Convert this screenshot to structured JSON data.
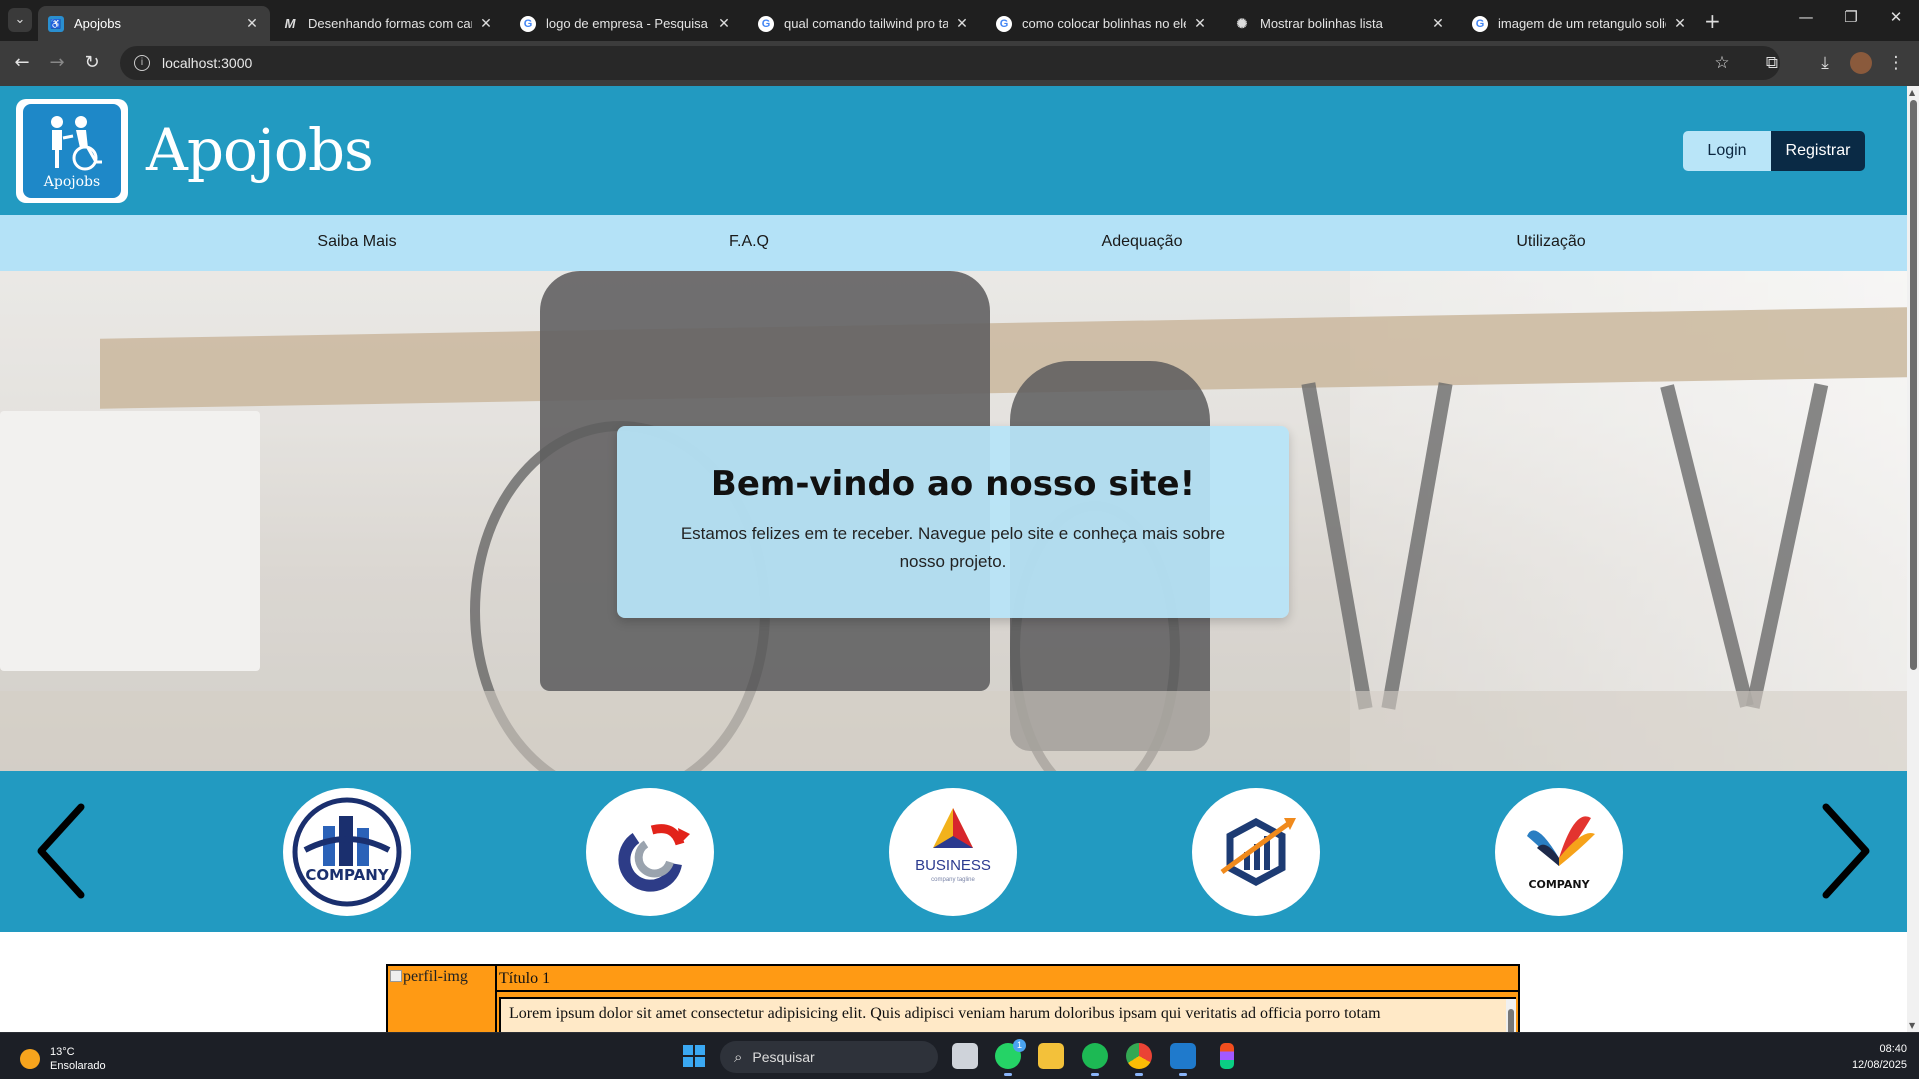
{
  "browser": {
    "tabs": [
      {
        "title": "Apojobs",
        "favicon": "apojobs-favicon",
        "active": true
      },
      {
        "title": "Desenhando formas com canva",
        "favicon": "medium-favicon"
      },
      {
        "title": "logo de empresa - Pesquisa Go",
        "favicon": "google-favicon"
      },
      {
        "title": "qual comando tailwind pro tam",
        "favicon": "google-favicon"
      },
      {
        "title": "como colocar bolinhas no elem",
        "favicon": "google-favicon"
      },
      {
        "title": "Mostrar bolinhas lista",
        "favicon": "chatgpt-favicon"
      },
      {
        "title": "imagem de um retangulo solid",
        "favicon": "google-favicon"
      }
    ],
    "url": "localhost:3000"
  },
  "site": {
    "logo_caption": "Apojobs",
    "brand": "Apojobs",
    "login_label": "Login",
    "register_label": "Registrar",
    "nav": [
      "Saiba Mais",
      "F.A.Q",
      "Adequação",
      "Utilização"
    ],
    "hero": {
      "title": "Bem-vindo ao nosso site!",
      "text": "Estamos felizes em te receber. Navegue pelo site e conheça mais sobre nosso projeto."
    },
    "partners": [
      {
        "name": "company-building-logo",
        "label": "COMPANY",
        "color": "#1a2f6e"
      },
      {
        "name": "swirl-logo",
        "label": "",
        "color": "#e2231a"
      },
      {
        "name": "business-triangle-logo",
        "label": "BUSINESS",
        "sub": "company tagline",
        "color": "#2b3a8f"
      },
      {
        "name": "hexagon-chart-logo",
        "label": "",
        "color": "#1d3b73"
      },
      {
        "name": "wings-logo",
        "label": "COMPANY",
        "color": "#e3342f"
      }
    ],
    "card": {
      "image_alt": "perfil-img",
      "title": "Título 1",
      "body": "Lorem ipsum dolor sit amet consectetur adipisicing elit. Quis adipisci veniam harum doloribus ipsam qui veritatis ad officia porro totam"
    }
  },
  "taskbar": {
    "weather_temp": "13°C",
    "weather_desc": "Ensolarado",
    "search_placeholder": "Pesquisar",
    "whatsapp_badge": "1",
    "time": "08:40",
    "date": "12/08/2025"
  }
}
